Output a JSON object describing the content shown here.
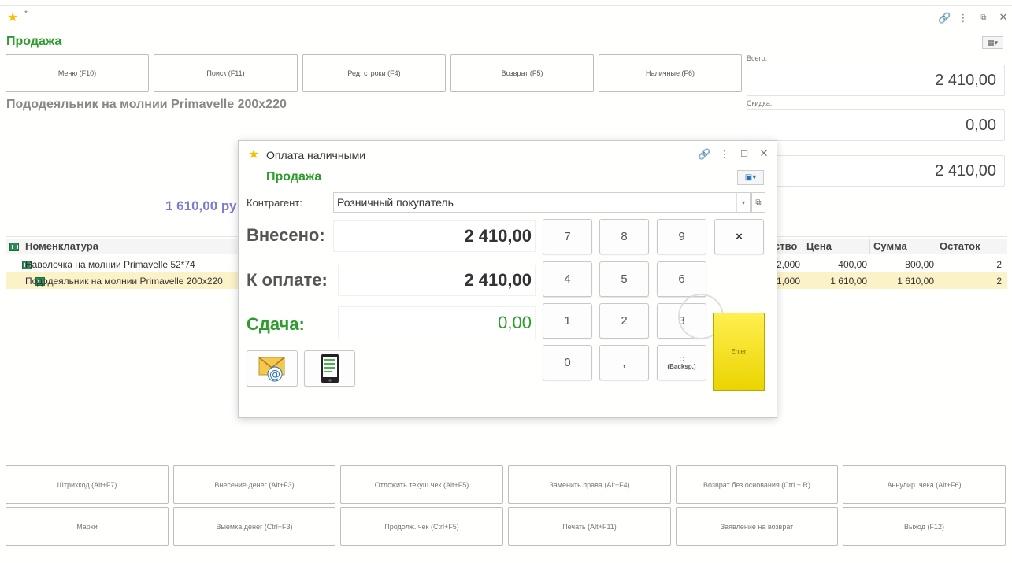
{
  "app": {
    "star_icon": "star-icon",
    "title": "Продажа"
  },
  "toolbar": {
    "buttons": [
      "Меню (F10)",
      "Поиск (F11)",
      "Ред. строки (F4)",
      "Возврат (F5)",
      "Наличные (F6)"
    ]
  },
  "product": {
    "name": "Пододеяльник на молнии Primavelle 200х220",
    "price": "1 610,00 ру"
  },
  "totals": {
    "total_label": "Всего:",
    "total_value": "2 410,00",
    "discount_label": "Скидка:",
    "discount_value": "0,00",
    "to_pay_value": "2 410,00"
  },
  "table": {
    "headers": {
      "nomenclature": "Номенклатура",
      "quantity": "ство",
      "price": "Цена",
      "sum": "Сумма",
      "remainder": "Остаток"
    },
    "rows": [
      {
        "name": "Наволочка на молнии Primavelle 52*74",
        "quantity": "2,000",
        "price": "400,00",
        "sum": "800,00",
        "remainder": "2"
      },
      {
        "name": "Пододеяльник на молнии Primavelle 200х220",
        "quantity": "1,000",
        "price": "1 610,00",
        "sum": "1 610,00",
        "remainder": "2"
      }
    ]
  },
  "dialog": {
    "title": "Оплата наличными",
    "subtitle": "Продажа",
    "counterparty_label": "Контрагент:",
    "counterparty_value": "Розничный покупатель",
    "deposited_label": "Внесено:",
    "deposited_value": "2 410,00",
    "to_pay_label": "К оплате:",
    "to_pay_value": "2 410,00",
    "change_label": "Сдача:",
    "change_value": "0,00",
    "keys": {
      "k7": "7",
      "k8": "8",
      "k9": "9",
      "clear": "×",
      "k4": "4",
      "k5": "5",
      "k6": "6",
      "k1": "1",
      "k2": "2",
      "k3": "3",
      "k0": "0",
      "comma": ",",
      "backspace_c": "С",
      "backspace_label": "(Backsp.)",
      "enter": "Enter"
    }
  },
  "bottom": {
    "row1": [
      "Штрихкод (Alt+F7)",
      "Внесение денег (Alt+F3)",
      "Отложить текущ.чек (Alt+F5)",
      "Заменить права (Alt+F4)",
      "Возврат без основания (Ctrl + R)",
      "Аннулир. чека (Alt+F6)"
    ],
    "row2": [
      "Марки",
      "Выемка денег (Ctrl+F3)",
      "Продолж. чек (Ctrl+F5)",
      "Печать (Alt+F11)",
      "Заявление на возврат",
      "Выход (F12)"
    ]
  }
}
